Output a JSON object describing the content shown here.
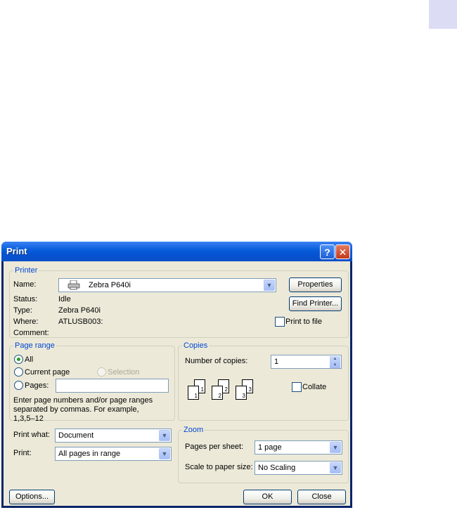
{
  "dialog": {
    "title": "Print",
    "help_btn": "?",
    "close_btn": "✕"
  },
  "printer": {
    "group_title": "Printer",
    "name_label": "Name:",
    "name_value": "Zebra P640i",
    "status_label": "Status:",
    "status_value": "Idle",
    "type_label": "Type:",
    "type_value": "Zebra P640i",
    "where_label": "Where:",
    "where_value": "ATLUSB003:",
    "comment_label": "Comment:",
    "properties_btn": "Properties",
    "find_printer_btn": "Find Printer...",
    "print_to_file_label": "Print to file",
    "print_to_file_checked": false
  },
  "page_range": {
    "group_title": "Page range",
    "all_label": "All",
    "current_page_label": "Current page",
    "selection_label": "Selection",
    "pages_label": "Pages:",
    "pages_value": "",
    "selected": "all",
    "hint": "Enter page numbers and/or page ranges separated by commas. For example, 1,3,5–12"
  },
  "copies": {
    "group_title": "Copies",
    "number_label": "Number of copies:",
    "number_value": "1",
    "collate_label": "Collate",
    "collate_checked": false,
    "icon_pages": [
      "1",
      "1",
      "2",
      "2",
      "3",
      "3"
    ]
  },
  "print_options": {
    "print_what_label": "Print what:",
    "print_what_value": "Document",
    "print_label": "Print:",
    "print_value": "All pages in range"
  },
  "zoom": {
    "group_title": "Zoom",
    "pages_per_sheet_label": "Pages per sheet:",
    "pages_per_sheet_value": "1 page",
    "scale_label": "Scale to paper size:",
    "scale_value": "No Scaling"
  },
  "footer": {
    "options_btn": "Options...",
    "ok_btn": "OK",
    "close_btn": "Close"
  },
  "colors": {
    "titlebar": "#0554d4",
    "group_title": "#0046d5",
    "dialog_bg": "#ece9d8"
  }
}
